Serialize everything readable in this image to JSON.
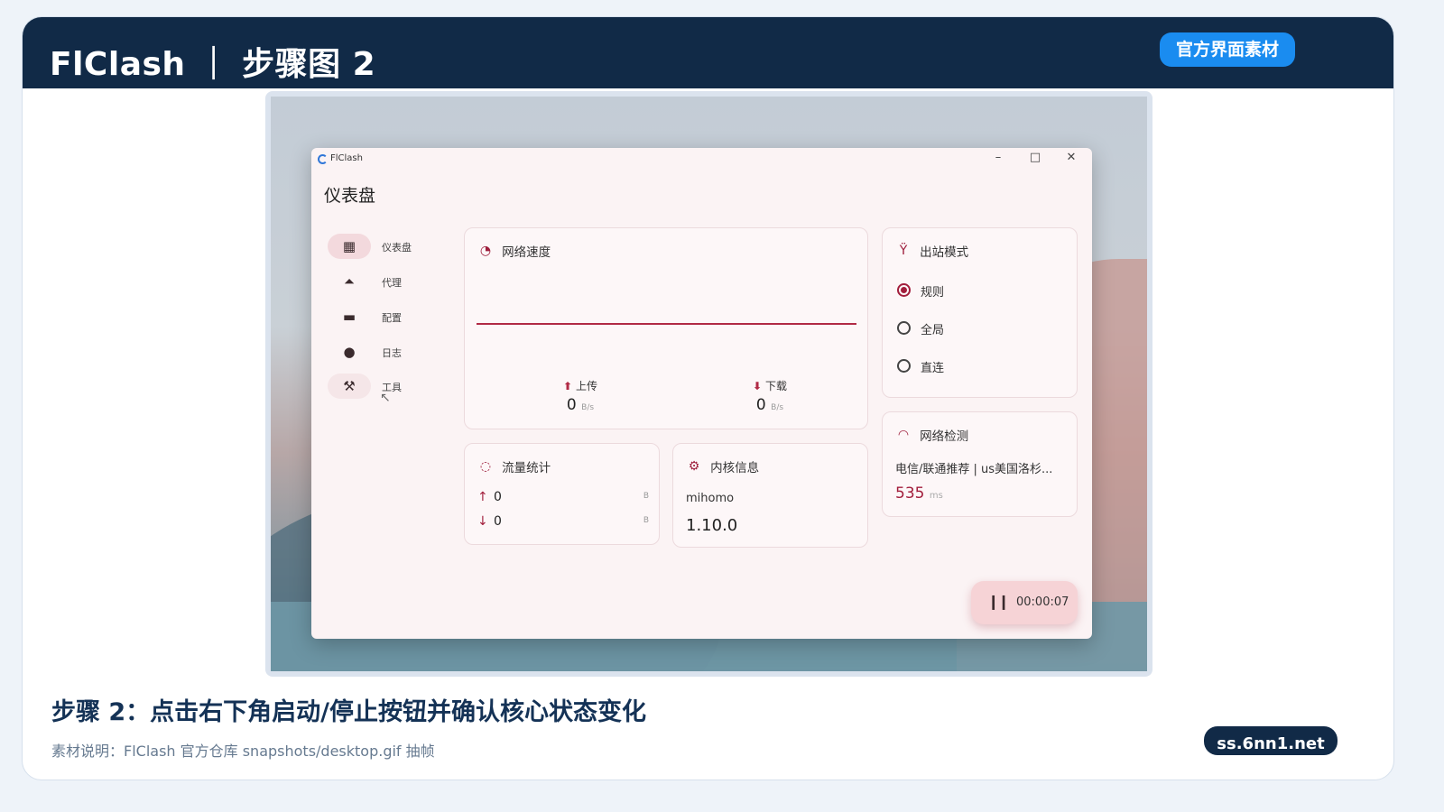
{
  "banner": {
    "title": "FlClash ｜ 步骤图 2",
    "badge": "官方界面素材"
  },
  "app": {
    "window_title": "FlClash",
    "window_controls": {
      "minimize": "–",
      "maximize": "□",
      "close": "✕"
    },
    "page_title": "仪表盘",
    "nav": [
      {
        "label": "仪表盘",
        "icon": "dashboard-icon",
        "state": "active"
      },
      {
        "label": "代理",
        "icon": "rocket-icon",
        "state": "normal"
      },
      {
        "label": "配置",
        "icon": "folder-icon",
        "state": "normal"
      },
      {
        "label": "日志",
        "icon": "bug-icon",
        "state": "normal"
      },
      {
        "label": "工具",
        "icon": "tools-icon",
        "state": "hover"
      }
    ],
    "speed": {
      "title": "网络速度",
      "upload_label": "上传",
      "upload_value": "0",
      "download_label": "下载",
      "download_value": "0",
      "unit": "B/s"
    },
    "outbound": {
      "title": "出站模式",
      "options": [
        "规则",
        "全局",
        "直连"
      ],
      "selected": "规则"
    },
    "traffic": {
      "title": "流量统计",
      "up_value": "0",
      "down_value": "0",
      "unit": "B"
    },
    "core": {
      "title": "内核信息",
      "name": "mihomo",
      "version": "1.10.0"
    },
    "network_check": {
      "title": "网络检测",
      "node": "电信/联通推荐 | us美国洛杉...",
      "delay": "535",
      "unit": "ms"
    },
    "timer": "00:00:07"
  },
  "caption": {
    "title": "步骤 2：点击右下角启动/停止按钮并确认核心状态变化",
    "note": "素材说明：FlClash 官方仓库 snapshots/desktop.gif 抽帧"
  },
  "site_badge": "ss.6nn1.net",
  "colors": {
    "banner": "#112a47",
    "badge": "#1a8cf0",
    "accent": "#a21e3c",
    "window_bg": "#fbf3f4"
  }
}
